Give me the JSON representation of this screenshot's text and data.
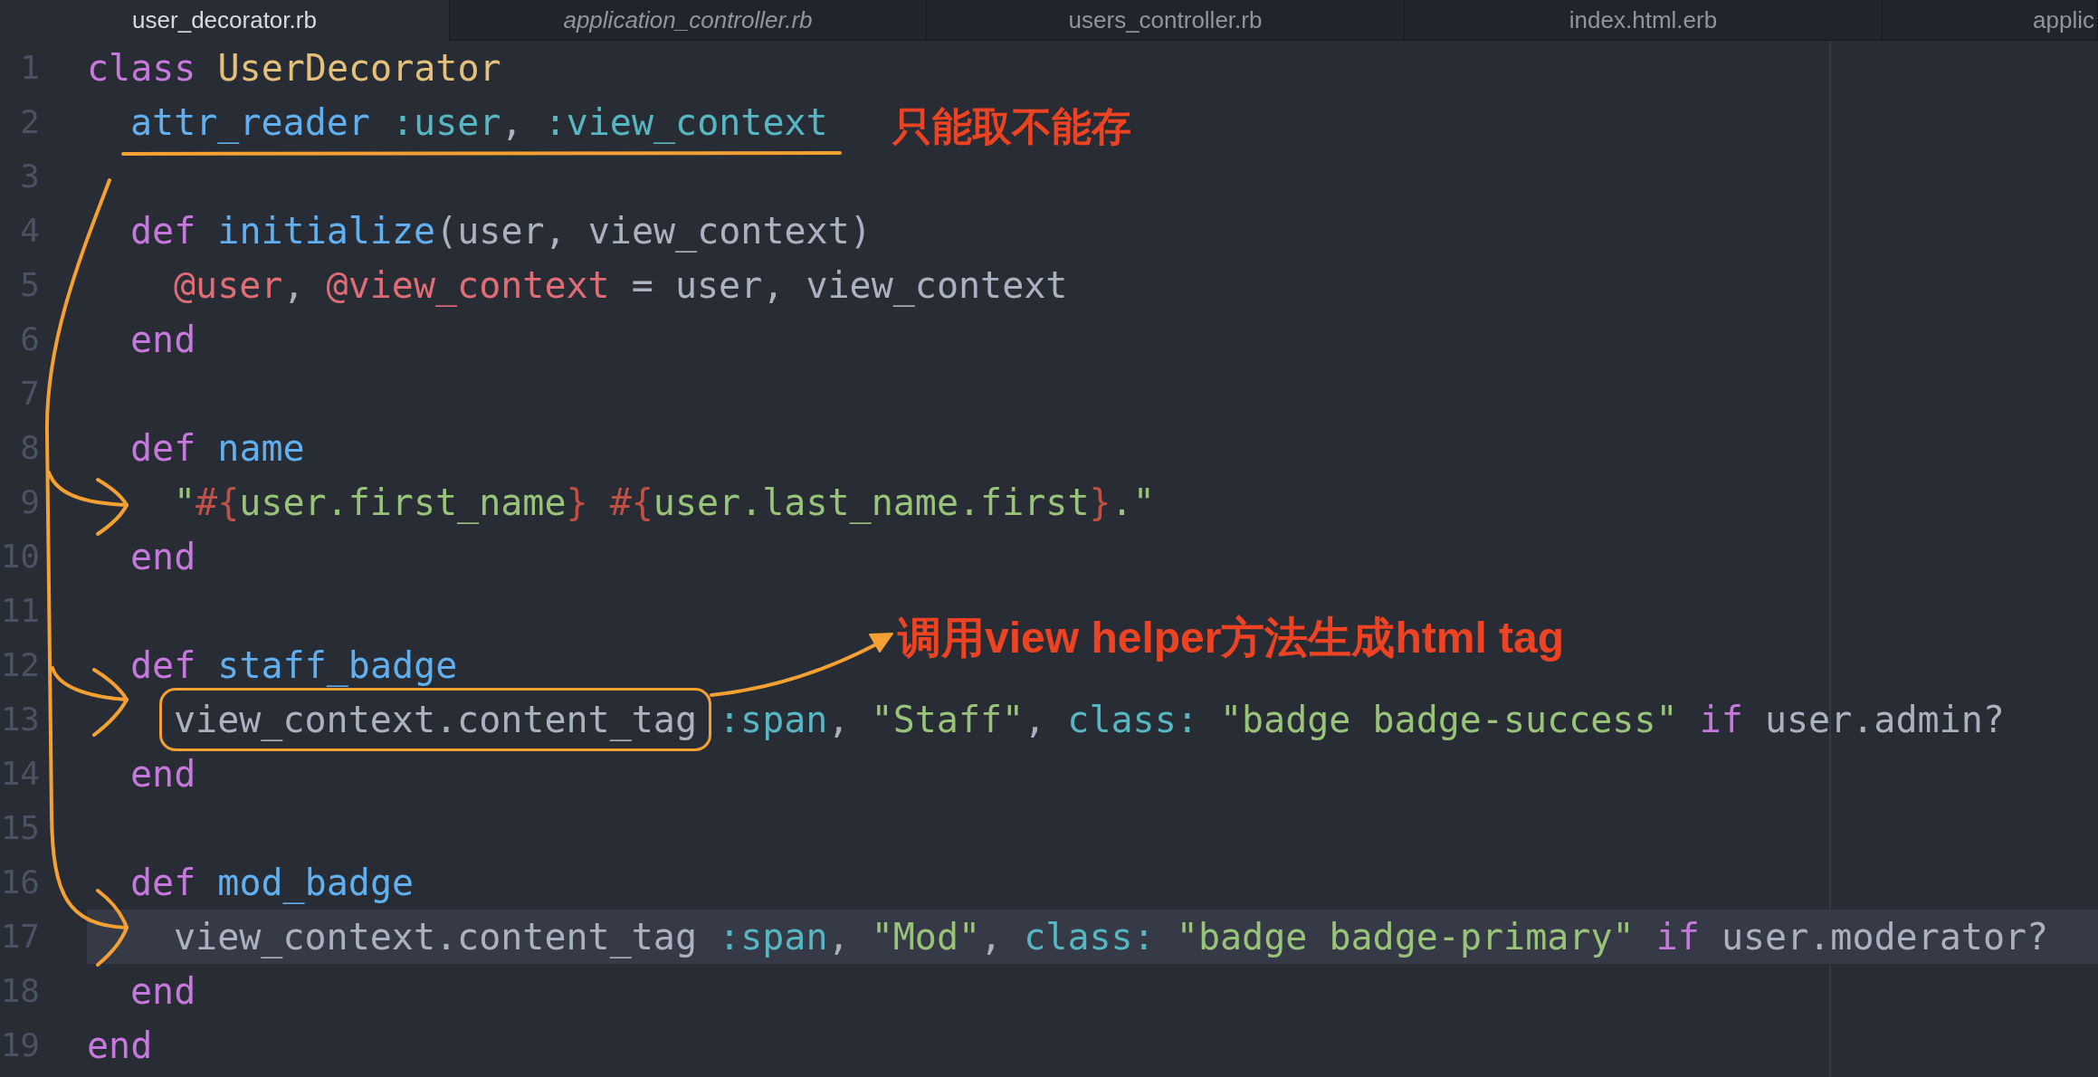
{
  "tabs": [
    {
      "label": "user_decorator.rb",
      "selected": true,
      "pending": false
    },
    {
      "label": "application_controller.rb",
      "selected": false,
      "pending": true
    },
    {
      "label": "users_controller.rb",
      "selected": false,
      "pending": false
    },
    {
      "label": "index.html.erb",
      "selected": false,
      "pending": false
    },
    {
      "label": "applic",
      "selected": false,
      "pending": false
    }
  ],
  "editor": {
    "lines": [
      {
        "number": "1",
        "active": false,
        "tokens": [
          {
            "kind": "keyword",
            "text": "class "
          },
          {
            "kind": "class",
            "text": "UserDecorator"
          }
        ],
        "children": [
          {
            "number": "2",
            "active": false,
            "tokens": [
              {
                "kind": "function",
                "text": "attr_reader "
              },
              {
                "kind": "symbol",
                "text": ":user"
              },
              {
                "kind": "plain",
                "text": ", "
              },
              {
                "kind": "symbol",
                "text": ":view_context"
              }
            ]
          },
          {
            "number": "3",
            "active": false
          },
          {
            "number": "4",
            "active": false,
            "tokens": [
              {
                "kind": "keyword",
                "text": "def "
              },
              {
                "kind": "function",
                "text": "initialize"
              },
              {
                "kind": "plain",
                "text": "(user, view_context)"
              }
            ],
            "children": [
              {
                "number": "5",
                "active": false,
                "tokens": [
                  {
                    "kind": "ivar",
                    "text": "@user"
                  },
                  {
                    "kind": "plain",
                    "text": ", "
                  },
                  {
                    "kind": "ivar",
                    "text": "@view_context"
                  },
                  {
                    "kind": "plain",
                    "text": " = user, view_context"
                  }
                ]
              }
            ]
          },
          {
            "number": "6",
            "active": false,
            "tokens": [
              {
                "kind": "keyword",
                "text": "end"
              }
            ]
          },
          {
            "number": "7",
            "active": false
          },
          {
            "number": "8",
            "active": false,
            "tokens": [
              {
                "kind": "keyword",
                "text": "def "
              },
              {
                "kind": "function",
                "text": "name"
              }
            ],
            "children": [
              {
                "number": "9",
                "active": false,
                "tokens": [
                  {
                    "kind": "string",
                    "text": "\""
                  },
                  {
                    "kind": "interpolation",
                    "text": "#{"
                  },
                  {
                    "kind": "string",
                    "text": "user.first_name"
                  },
                  {
                    "kind": "interpolation",
                    "text": "} #{"
                  },
                  {
                    "kind": "string",
                    "text": "user.last_name.first"
                  },
                  {
                    "kind": "interpolation",
                    "text": "}"
                  },
                  {
                    "kind": "string",
                    "text": ".\""
                  }
                ]
              }
            ]
          },
          {
            "number": "10",
            "active": false,
            "tokens": [
              {
                "kind": "keyword",
                "text": "end"
              }
            ]
          },
          {
            "number": "11",
            "active": false
          },
          {
            "number": "12",
            "active": false,
            "tokens": [
              {
                "kind": "keyword",
                "text": "def "
              },
              {
                "kind": "function",
                "text": "staff_badge"
              }
            ],
            "children": [
              {
                "number": "13",
                "active": false,
                "framed": {
                  "kind": "plain",
                  "text": "view_context.content_tag"
                },
                "tokens": [
                  {
                    "kind": "symbol",
                    "text": ":span"
                  },
                  {
                    "kind": "plain",
                    "text": ", "
                  },
                  {
                    "kind": "string",
                    "text": "\"Staff\""
                  },
                  {
                    "kind": "plain",
                    "text": ", "
                  },
                  {
                    "kind": "symbol",
                    "text": "class:"
                  },
                  {
                    "kind": "string",
                    "text": " \"badge badge-success\""
                  },
                  {
                    "kind": "keyword",
                    "text": " if"
                  },
                  {
                    "kind": "plain",
                    "text": " user.admin?"
                  }
                ]
              }
            ]
          },
          {
            "number": "14",
            "active": false,
            "tokens": [
              {
                "kind": "keyword",
                "text": "end"
              }
            ]
          },
          {
            "number": "15",
            "active": false
          },
          {
            "number": "16",
            "active": false,
            "tokens": [
              {
                "kind": "keyword",
                "text": "def "
              },
              {
                "kind": "function",
                "text": "mod_badge"
              }
            ],
            "children": [
              {
                "number": "17",
                "active": true,
                "tokens": [
                  {
                    "kind": "plain",
                    "text": "view_context.content_tag "
                  },
                  {
                    "kind": "symbol",
                    "text": ":span"
                  },
                  {
                    "kind": "plain",
                    "text": ", "
                  },
                  {
                    "kind": "string",
                    "text": "\"Mod\""
                  },
                  {
                    "kind": "plain",
                    "text": ", "
                  },
                  {
                    "kind": "symbol",
                    "text": "class:"
                  },
                  {
                    "kind": "string",
                    "text": " \"badge badge-primary\""
                  },
                  {
                    "kind": "keyword",
                    "text": " if"
                  },
                  {
                    "kind": "plain",
                    "text": " user.moderator?"
                  }
                ]
              }
            ]
          },
          {
            "number": "18",
            "active": false,
            "tokens": [
              {
                "kind": "keyword",
                "text": "end"
              }
            ]
          }
        ]
      },
      {
        "number": "19",
        "active": false,
        "tokens": [
          {
            "kind": "keyword",
            "text": "end"
          }
        ]
      }
    ]
  },
  "annotations": [
    {
      "text": "只能取不能存"
    },
    {
      "text": "调用view helper方法生成html tag"
    }
  ]
}
